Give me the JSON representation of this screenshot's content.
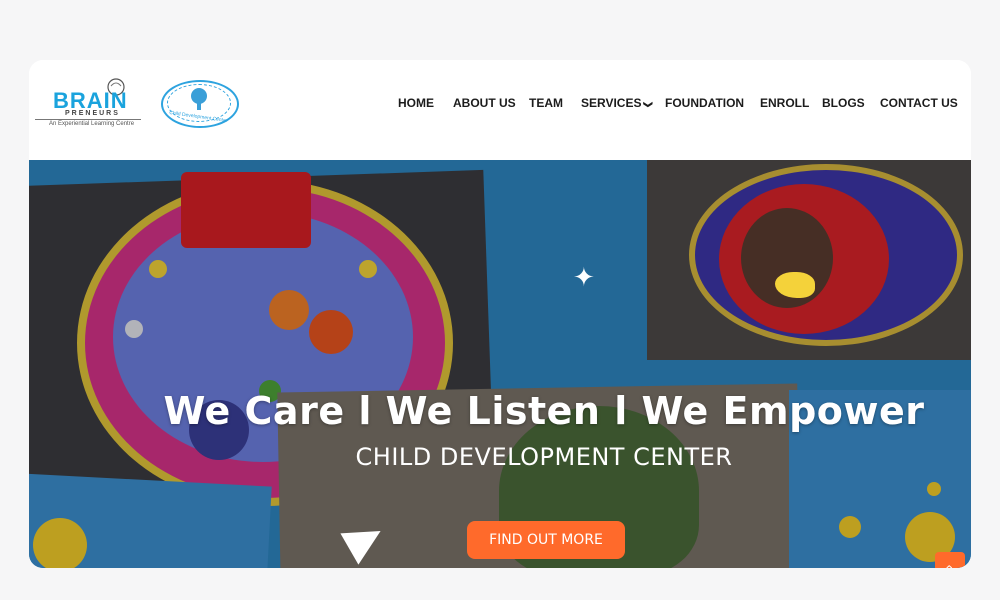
{
  "logos": {
    "brain_word": "BRAIN",
    "brain_sub": "PRENEURS",
    "brain_tag": "An Experiential Learning Centre",
    "cdc_text": "Child Development Center"
  },
  "nav": {
    "items": [
      {
        "label": "HOME"
      },
      {
        "label": "ABOUT US"
      },
      {
        "label": "TEAM"
      },
      {
        "label": "SERVICES",
        "has_dropdown": true
      },
      {
        "label": "FOUNDATION"
      },
      {
        "label": "ENROLL"
      },
      {
        "label": "BLOGS"
      },
      {
        "label": "CONTACT US"
      }
    ],
    "dropdown_glyph": "❯"
  },
  "hero": {
    "headline": "We Care l We Listen l We Empower",
    "subheadline": "CHILD DEVELOPMENT CENTER",
    "cta_label": "FIND OUT MORE",
    "scroll_top_glyph": "‹"
  },
  "colors": {
    "accent": "#ff6a2b",
    "brand_blue": "#1aa3dd",
    "hero_blue": "#2e86c1"
  }
}
